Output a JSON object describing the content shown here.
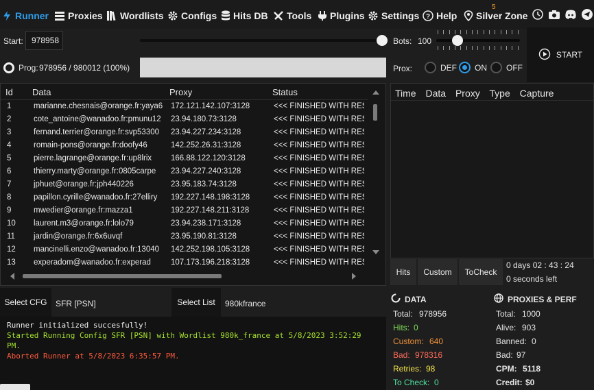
{
  "nav": {
    "items": [
      {
        "label": "Runner",
        "icon": "runner-icon"
      },
      {
        "label": "Proxies",
        "icon": "proxies-icon"
      },
      {
        "label": "Wordlists",
        "icon": "wordlists-icon"
      },
      {
        "label": "Configs",
        "icon": "gear-icon"
      },
      {
        "label": "Hits DB",
        "icon": "database-icon"
      },
      {
        "label": "Tools",
        "icon": "tools-icon"
      },
      {
        "label": "Plugins",
        "icon": "plug-icon"
      },
      {
        "label": "Settings",
        "icon": "gear-icon"
      },
      {
        "label": "Help",
        "icon": "help-icon"
      },
      {
        "label": "Silver Zone",
        "icon": "location-icon"
      }
    ],
    "badge": "5",
    "active_color": "#2f9ce8"
  },
  "runner": {
    "start_label": "Start:",
    "start_value": "978958",
    "bots_label": "Bots:",
    "bots_value": "100",
    "start_button": "START",
    "prog_label": "Prog:",
    "progress_text": "978956 / 980012 (100%)",
    "progress_fraction": 0.999,
    "start_slider_fraction": 0.999,
    "bots_slider_fraction": 0.25,
    "prox_label": "Prox:",
    "prox_options": [
      "DEF",
      "ON",
      "OFF"
    ],
    "prox_selected": "ON"
  },
  "grid": {
    "headers": [
      "Id",
      "Data",
      "Proxy",
      "Status"
    ],
    "rows": [
      [
        "1",
        "marianne.chesnais@orange.fr:yaya6",
        "172.121.142.107:3128",
        "<<< FINISHED WITH RES"
      ],
      [
        "2",
        "cote_antoine@wanadoo.fr:pmunu12",
        "23.94.180.73:3128",
        "<<< FINISHED WITH RES"
      ],
      [
        "3",
        "fernand.terrier@orange.fr:svp53300",
        "23.94.227.234:3128",
        "<<< FINISHED WITH RES"
      ],
      [
        "4",
        "romain-pons@orange.fr:doofy46",
        "142.252.26.31:3128",
        "<<< FINISHED WITH RES"
      ],
      [
        "5",
        "pierre.lagrange@orange.fr:up8lrix",
        "166.88.122.120:3128",
        "<<< FINISHED WITH RES"
      ],
      [
        "6",
        "thierry.marty@orange.fr:0805carpe",
        "23.94.227.240:3128",
        "<<< FINISHED WITH RES"
      ],
      [
        "7",
        "jphuet@orange.fr:jph440226",
        "23.95.183.74:3128",
        "<<< FINISHED WITH RES"
      ],
      [
        "8",
        "papillon.cyrille@wanadoo.fr:27elliry",
        "192.227.148.198:3128",
        "<<< FINISHED WITH RES"
      ],
      [
        "9",
        "mwedier@orange.fr:mazza1",
        "192.227.148.211:3128",
        "<<< FINISHED WITH RES"
      ],
      [
        "10",
        "laurent.m3@orange.fr:lolo79",
        "23.94.238.171:3128",
        "<<< FINISHED WITH RES"
      ],
      [
        "11",
        "jardin@orange.fr:6x6uvqf",
        "23.95.190.81:3128",
        "<<< FINISHED WITH RES"
      ],
      [
        "12",
        "mancinelli.enzo@wanadoo.fr:13040",
        "142.252.198.105:3128",
        "<<< FINISHED WITH RES"
      ],
      [
        "13",
        "experadom@wanadoo.fr:experad",
        "107.173.196.218:3128",
        "<<< FINISHED WITH RES"
      ]
    ]
  },
  "capture": {
    "headers": [
      "Time",
      "Data",
      "Proxy",
      "Type",
      "Capture"
    ],
    "tabs": [
      "Hits",
      "Custom",
      "ToCheck"
    ],
    "elapsed": "0  days  02 : 43 : 24",
    "remaining": "0 seconds left"
  },
  "selection": {
    "cfg_button": "Select CFG",
    "cfg_value": "SFR [PSN]",
    "list_button": "Select List",
    "list_value": "980kfrance"
  },
  "log": [
    {
      "text": "Runner initialized succesfully!",
      "color": "#f0f0f0"
    },
    {
      "text": "Started Running Config SFR [PSN] with Wordlist 980k_france at 5/8/2023 3:52:29 PM.",
      "color": "#a6e22e"
    },
    {
      "text": "Aborted Runner at 5/8/2023 6:35:57 PM.",
      "color": "#ff5a3c"
    }
  ],
  "data_stats": {
    "title": "DATA",
    "items": [
      {
        "label": "Total:",
        "value": "978956",
        "color": "#e6e6e6"
      },
      {
        "label": "Hits:",
        "value": "0",
        "color": "#7ed957"
      },
      {
        "label": "Custom:",
        "value": "640",
        "color": "#f0913a"
      },
      {
        "label": "Bad:",
        "value": "978316",
        "color": "#ff6b5a"
      },
      {
        "label": "Retries:",
        "value": "98",
        "color": "#f5e64a"
      },
      {
        "label": "To Check:",
        "value": "0",
        "color": "#4fe0a0"
      }
    ]
  },
  "perf_stats": {
    "title": "PROXIES & PERF",
    "items": [
      {
        "label": "Total:",
        "value": "1000",
        "bold": false
      },
      {
        "label": "Alive:",
        "value": "903",
        "bold": false
      },
      {
        "label": "Banned:",
        "value": "0",
        "bold": false
      },
      {
        "label": "Bad:",
        "value": "97",
        "bold": false
      },
      {
        "label": "CPM:",
        "value": "5118",
        "bold": true
      },
      {
        "label": "Credit:",
        "value": "$0",
        "bold": true
      }
    ]
  }
}
